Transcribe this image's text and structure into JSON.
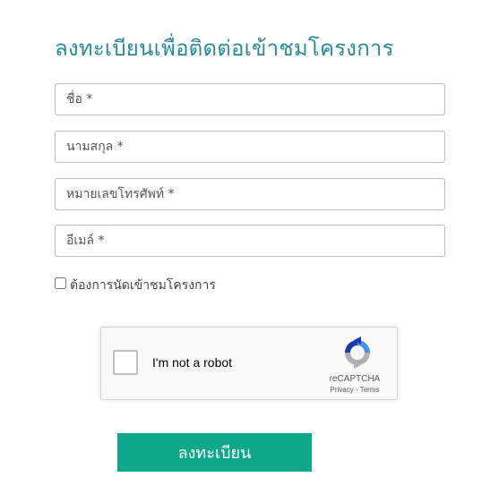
{
  "form": {
    "title": "ลงทะเบียนเพื่อติดต่อเข้าชมโครงการ",
    "fields": {
      "first_name": {
        "value": "",
        "placeholder": "ชื่อ *"
      },
      "last_name": {
        "value": "",
        "placeholder": "นามสกุล *"
      },
      "phone": {
        "value": "",
        "placeholder": "หมายเลขโทรศัพท์ *"
      },
      "email": {
        "value": "",
        "placeholder": "อีเมล์ *"
      }
    },
    "visit_checkbox": {
      "label": "ต้องการนัดเข้าชมโครงการ",
      "checked": false
    },
    "recaptcha": {
      "label": "I'm not a robot",
      "brand": "reCAPTCHA",
      "privacy": "Privacy",
      "separator": " - ",
      "terms": "Terms"
    },
    "submit_label": "ลงทะเบียน"
  },
  "colors": {
    "title": "#2b8a98",
    "button": "#0ea88a",
    "button_text": "#ffffff",
    "border": "#bdbdbd",
    "recaptcha_blue": "#4a90e2",
    "recaptcha_dark_blue": "#1c3aa9",
    "recaptcha_gray": "#b0b0b0"
  },
  "icons": {
    "recaptcha_logo": "recaptcha-logo-icon"
  }
}
